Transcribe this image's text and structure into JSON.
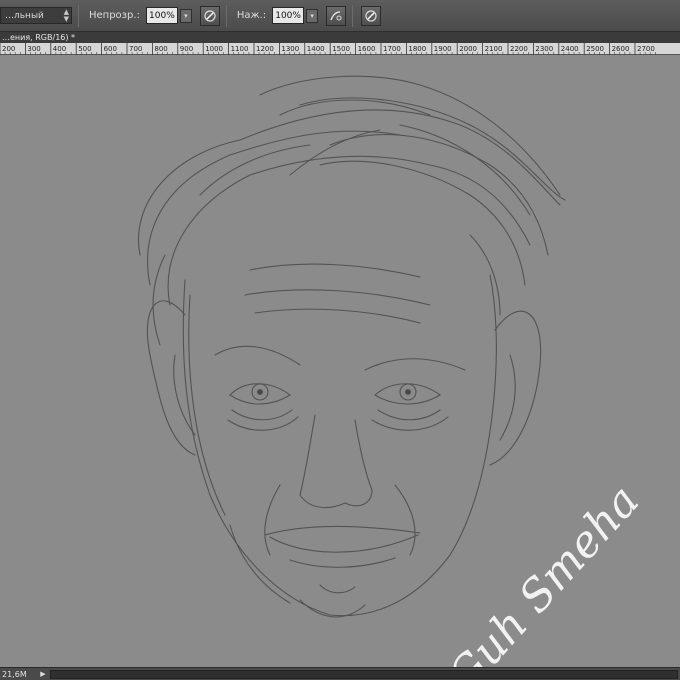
{
  "options_bar": {
    "blend_mode": "…льный",
    "opacity_label": "Непрозр.:",
    "opacity_value": "100%",
    "pressure_label": "Наж.:",
    "pressure_value": "100%"
  },
  "document": {
    "tab_title": "…ения, RGB/16) *"
  },
  "ruler": {
    "ticks": [
      "200",
      "300",
      "400",
      "500",
      "600",
      "700",
      "800",
      "900",
      "1000",
      "1100",
      "1200",
      "1300",
      "1400",
      "1500",
      "1600",
      "1700",
      "1800",
      "1900",
      "2000",
      "2100",
      "2200",
      "2300",
      "2400",
      "2500",
      "2600",
      "2700"
    ]
  },
  "artwork": {
    "signature": "Guh Smeha"
  },
  "status_bar": {
    "doc_size": "21,6М"
  },
  "colors": {
    "canvas": "#8b8b8b",
    "sketch_stroke": "#4a4a4a",
    "signature": "#f2f2f2"
  }
}
